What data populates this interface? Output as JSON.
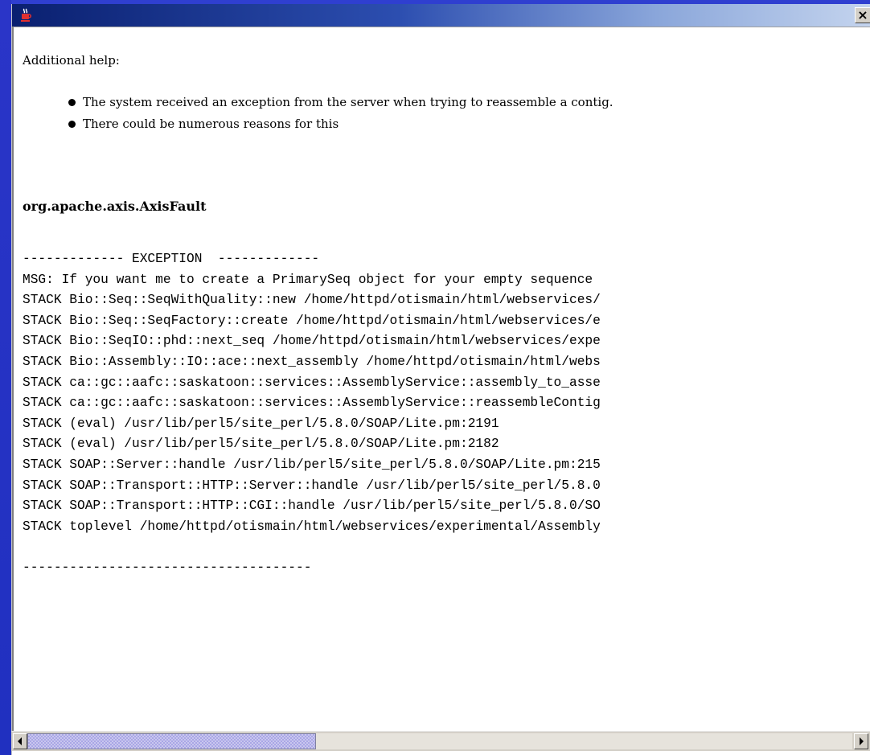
{
  "window": {
    "close_label": "×",
    "icon": "java-cup-icon"
  },
  "help": {
    "label": "Additional help:",
    "bullets": [
      "The system received an exception from the server when trying to reassemble a contig.",
      "There could be numerous reasons for this"
    ]
  },
  "error": {
    "title": "org.apache.axis.AxisFault",
    "lines": [
      "------------- EXCEPTION  -------------",
      "MSG: If you want me to create a PrimarySeq object for your empty sequence",
      "STACK Bio::Seq::SeqWithQuality::new /home/httpd/otismain/html/webservices/",
      "STACK Bio::Seq::SeqFactory::create /home/httpd/otismain/html/webservices/e",
      "STACK Bio::SeqIO::phd::next_seq /home/httpd/otismain/html/webservices/expe",
      "STACK Bio::Assembly::IO::ace::next_assembly /home/httpd/otismain/html/webs",
      "STACK ca::gc::aafc::saskatoon::services::AssemblyService::assembly_to_asse",
      "STACK ca::gc::aafc::saskatoon::services::AssemblyService::reassembleContig",
      "STACK (eval) /usr/lib/perl5/site_perl/5.8.0/SOAP/Lite.pm:2191",
      "STACK (eval) /usr/lib/perl5/site_perl/5.8.0/SOAP/Lite.pm:2182",
      "STACK SOAP::Server::handle /usr/lib/perl5/site_perl/5.8.0/SOAP/Lite.pm:215",
      "STACK SOAP::Transport::HTTP::Server::handle /usr/lib/perl5/site_perl/5.8.0",
      "STACK SOAP::Transport::HTTP::CGI::handle /usr/lib/perl5/site_perl/5.8.0/SO",
      "STACK toplevel /home/httpd/otismain/html/webservices/experimental/Assembly",
      "",
      "-------------------------------------"
    ]
  },
  "scrollbar": {
    "position_fraction": 0.0,
    "visible_fraction": 0.35
  },
  "colors": {
    "desktop": "#2f3fd0",
    "titlebar_start": "#0a2070",
    "titlebar_end": "#c4d4ee",
    "scroll_thumb": "#c9c7ee"
  }
}
